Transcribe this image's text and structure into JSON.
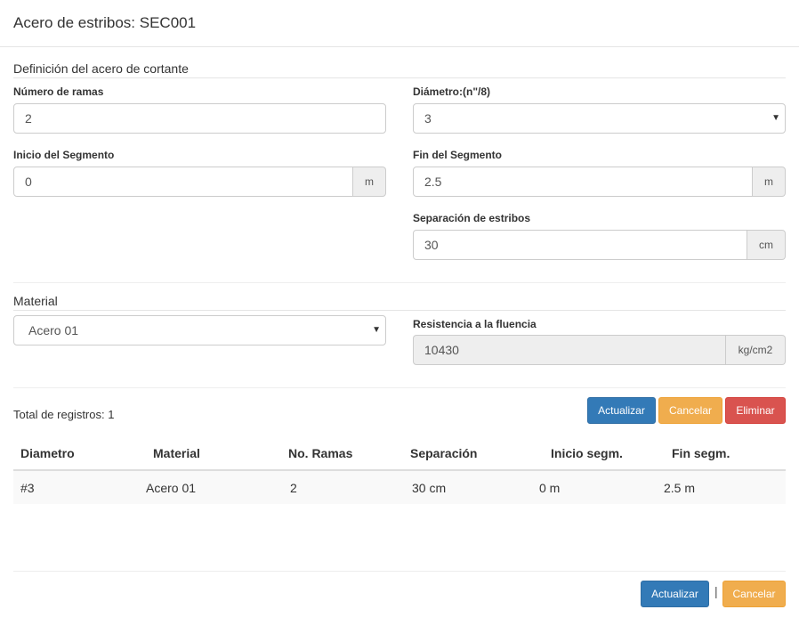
{
  "header": {
    "title": "Acero de estribos: SEC001"
  },
  "shear_section": {
    "title": "Definición del acero de cortante",
    "num_ramas": {
      "label": "Número de ramas",
      "value": "2"
    },
    "diametro": {
      "label": "Diámetro:(n\"/8)",
      "value": "3"
    },
    "inicio": {
      "label": "Inicio del Segmento",
      "value": "0",
      "unit": "m"
    },
    "fin": {
      "label": "Fin del Segmento",
      "value": "2.5",
      "unit": "m"
    },
    "separacion": {
      "label": "Separación de estribos",
      "value": "30",
      "unit": "cm"
    }
  },
  "material_section": {
    "title": "Material",
    "material": {
      "value": "Acero 01"
    },
    "resistencia": {
      "label": "Resistencia a la fluencia",
      "value": "10430",
      "unit": "kg/cm2"
    }
  },
  "records": {
    "total_label": "Total de registros: 1",
    "buttons": {
      "update": "Actualizar",
      "cancel": "Cancelar",
      "delete": "Eliminar"
    },
    "columns": [
      "Diametro",
      "Material",
      "No. Ramas",
      "Separación",
      "Inicio segm.",
      "Fin segm."
    ],
    "rows": [
      [
        "#3",
        "Acero 01",
        "2",
        "30 cm",
        "0 m",
        "2.5 m"
      ]
    ]
  },
  "footer": {
    "update": "Actualizar",
    "separator": "|",
    "cancel": "Cancelar"
  },
  "colors": {
    "primary": "#337ab7",
    "warning": "#f0ad4e",
    "danger": "#d9534f"
  }
}
